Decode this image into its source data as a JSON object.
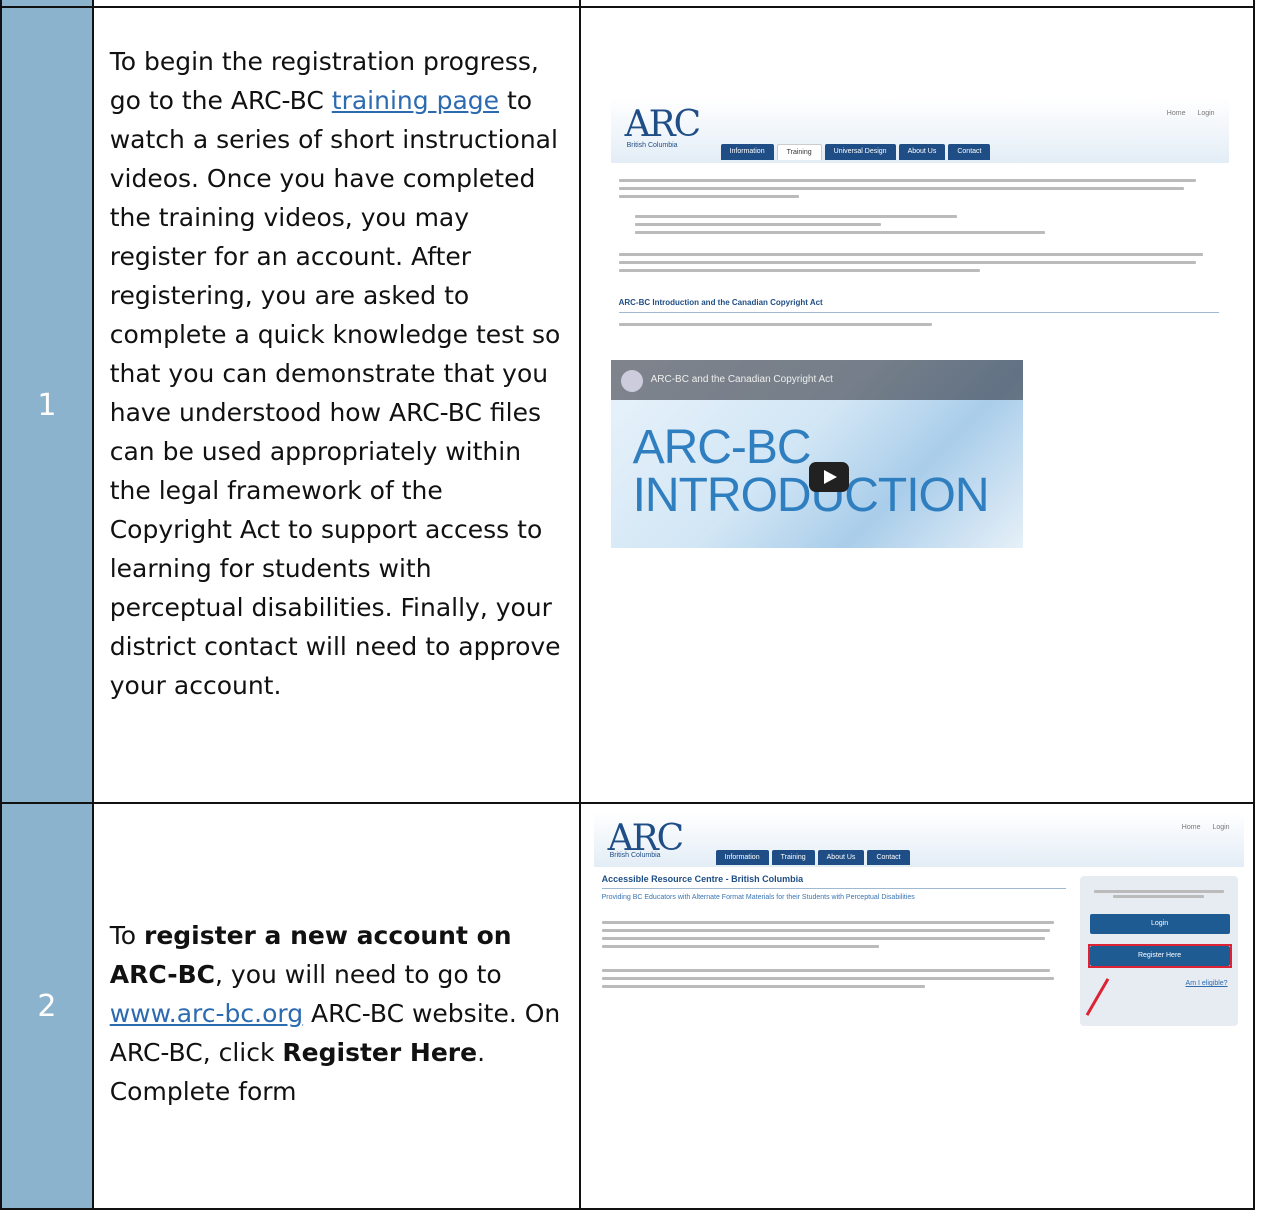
{
  "steps": [
    {
      "number": "1",
      "text_before_link": "To begin the registration progress, go to the ARC-BC ",
      "link": "training page",
      "text_after_link": " to watch a series of short instructional videos. Once you have completed the training videos, you may register for an account. After registering, you are asked to complete a quick knowledge test so that you can demonstrate that you have understood how ARC-BC files can be used appropriately within the legal framework of the Copyright Act to support access to learning for students with perceptual disabilities. Finally, your district contact will need to approve your account.",
      "screenshot": {
        "logo": "ARC",
        "logo_sub": "British Columbia",
        "top_links": [
          "Home",
          "Login"
        ],
        "tabs": [
          "Information",
          "Training",
          "Universal Design",
          "About Us",
          "Contact"
        ],
        "section_heading": "ARC-BC Introduction and the Canadian Copyright Act",
        "video_title": "ARC-BC and the Canadian Copyright Act",
        "video_big_line1": "ARC-BC",
        "video_big_line2": "INTRODUCTION"
      }
    },
    {
      "number": "2",
      "text_1": "To ",
      "bold_1": "register a new account on ARC-BC",
      "text_2": ", you will need to go to ",
      "link": "www.arc-bc.org",
      "text_3": " ARC-BC website. On ARC-BC, click ",
      "bold_2": "Register Here",
      "text_4": ". Complete form",
      "screenshot": {
        "logo": "ARC",
        "logo_sub": "British Columbia",
        "top_links": [
          "Home",
          "Login"
        ],
        "tabs": [
          "Information",
          "Training",
          "About Us",
          "Contact"
        ],
        "heading": "Accessible Resource Centre - British Columbia",
        "subheading": "Providing BC Educators with Alternate Format Materials for their Students with Perceptual Disabilities",
        "login_button": "Login",
        "register_button": "Register Here",
        "eligible_link": "Am I eligible?"
      }
    }
  ]
}
